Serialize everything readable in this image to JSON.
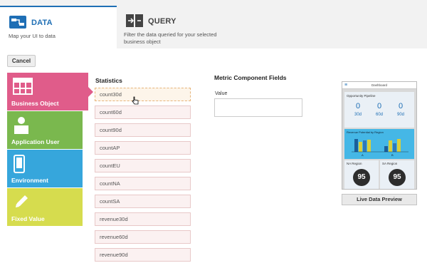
{
  "tabs": [
    {
      "title": "DATA",
      "desc": "Map your UI to data",
      "icon": "data-map-icon"
    },
    {
      "title": "QUERY",
      "desc": "Filter the data queried for your selected business object",
      "icon": "query-filter-icon"
    }
  ],
  "toolbar": {
    "cancel_label": "Cancel"
  },
  "sources": [
    {
      "label": "Business Object",
      "icon": "table-grid-icon",
      "color": "#e05c8a"
    },
    {
      "label": "Application User",
      "icon": "user-icon",
      "color": "#7ab84e"
    },
    {
      "label": "Environment",
      "icon": "mobile-device-icon",
      "color": "#36a6dc"
    },
    {
      "label": "Fixed Value",
      "icon": "pencil-icon",
      "color": "#d6dc4e"
    }
  ],
  "statistics": {
    "title": "Statistics",
    "items": [
      "count30d",
      "count60d",
      "count90d",
      "countAP",
      "countEU",
      "countNA",
      "countSA",
      "revenue30d",
      "revenue60d",
      "revenue90d"
    ],
    "selected": "count30d"
  },
  "metric": {
    "title": "Metric Component Fields",
    "value_label": "Value",
    "value": ""
  },
  "preview": {
    "title": "Dashboard",
    "pipeline_title": "Opportunity Pipeline",
    "pipeline": [
      {
        "value": "0",
        "label": "30d"
      },
      {
        "value": "0",
        "label": "60d"
      },
      {
        "value": "0",
        "label": "90d"
      }
    ],
    "chart_title": "Revenue Potential by Region",
    "chart_labels": [
      "A",
      "B"
    ],
    "regions": [
      {
        "title": "NA Region",
        "value": "95"
      },
      {
        "title": "SA Region",
        "value": "95"
      }
    ],
    "live_label": "Live Data Preview"
  }
}
